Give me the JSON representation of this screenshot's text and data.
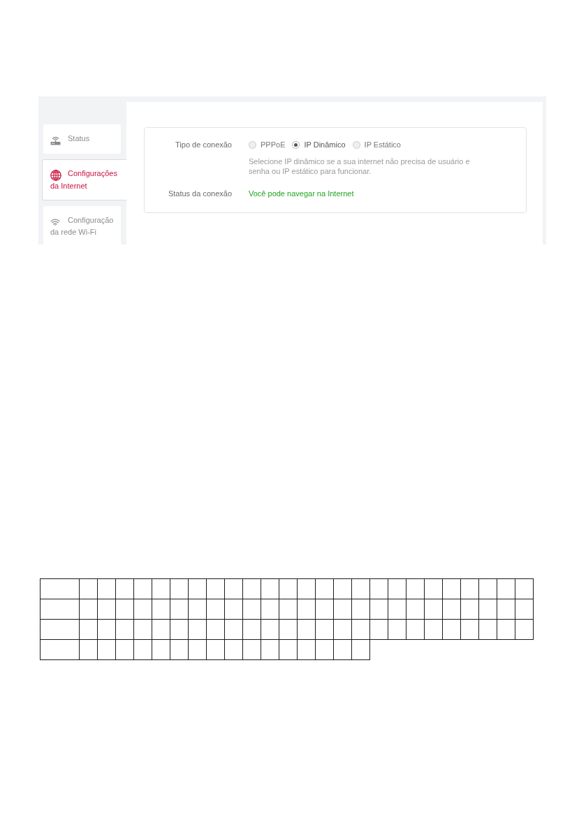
{
  "sidebar": {
    "items": [
      {
        "kind": "status",
        "label": "Status",
        "selected": false
      },
      {
        "kind": "internet",
        "label": "Configurações da Internet",
        "selected": true
      },
      {
        "kind": "wireless",
        "label": "Configuração da rede Wi-Fi",
        "selected": false
      }
    ]
  },
  "connection_form": {
    "connection_type": {
      "label": "Tipo de conexão",
      "options": [
        {
          "label": "PPPoE",
          "selected": false
        },
        {
          "label": "IP Dinâmico",
          "selected": true
        },
        {
          "label": "IP Estático",
          "selected": false
        }
      ],
      "description": "Selecione IP dinâmico se a sua internet não precisa de usuário e senha ou IP estático para funcionar."
    },
    "connection_status": {
      "label": "Status da conexão",
      "value": "Você pode navegar na Internet"
    }
  },
  "grid": {
    "rows": [
      {
        "cells": [
          {
            "kind": "wide"
          },
          {
            "kind": "narrow"
          },
          {
            "kind": "narrow"
          },
          {
            "kind": "narrow"
          },
          {
            "kind": "narrow"
          },
          {
            "kind": "narrow"
          },
          {
            "kind": "narrow"
          },
          {
            "kind": "narrow"
          },
          {
            "kind": "narrow"
          },
          {
            "kind": "narrow"
          },
          {
            "kind": "narrow"
          },
          {
            "kind": "narrow"
          },
          {
            "kind": "narrow"
          },
          {
            "kind": "narrow"
          },
          {
            "kind": "narrow"
          },
          {
            "kind": "narrow"
          },
          {
            "kind": "narrow"
          },
          {
            "kind": "narrow"
          },
          {
            "kind": "narrow"
          },
          {
            "kind": "narrow"
          },
          {
            "kind": "narrow"
          },
          {
            "kind": "narrow"
          },
          {
            "kind": "narrow"
          },
          {
            "kind": "narrow"
          },
          {
            "kind": "narrow"
          },
          {
            "kind": "narrow"
          }
        ]
      },
      {
        "cells": [
          {
            "kind": "wide"
          },
          {
            "kind": "narrow"
          },
          {
            "kind": "narrow"
          },
          {
            "kind": "narrow"
          },
          {
            "kind": "narrow"
          },
          {
            "kind": "narrow"
          },
          {
            "kind": "narrow"
          },
          {
            "kind": "narrow"
          },
          {
            "kind": "narrow"
          },
          {
            "kind": "narrow"
          },
          {
            "kind": "narrow"
          },
          {
            "kind": "narrow"
          },
          {
            "kind": "narrow"
          },
          {
            "kind": "narrow"
          },
          {
            "kind": "narrow"
          },
          {
            "kind": "narrow"
          },
          {
            "kind": "narrow"
          },
          {
            "kind": "narrow"
          },
          {
            "kind": "narrow"
          },
          {
            "kind": "narrow"
          },
          {
            "kind": "narrow"
          },
          {
            "kind": "narrow"
          },
          {
            "kind": "narrow"
          },
          {
            "kind": "narrow"
          },
          {
            "kind": "narrow"
          },
          {
            "kind": "narrow"
          }
        ]
      },
      {
        "cells": [
          {
            "kind": "wide"
          },
          {
            "kind": "narrow"
          },
          {
            "kind": "narrow"
          },
          {
            "kind": "narrow"
          },
          {
            "kind": "narrow"
          },
          {
            "kind": "narrow"
          },
          {
            "kind": "narrow"
          },
          {
            "kind": "narrow"
          },
          {
            "kind": "narrow"
          },
          {
            "kind": "narrow"
          },
          {
            "kind": "narrow"
          },
          {
            "kind": "narrow"
          },
          {
            "kind": "narrow"
          },
          {
            "kind": "narrow"
          },
          {
            "kind": "narrow"
          },
          {
            "kind": "narrow"
          },
          {
            "kind": "narrow"
          },
          {
            "kind": "narrow"
          },
          {
            "kind": "narrow"
          },
          {
            "kind": "narrow"
          },
          {
            "kind": "narrow"
          },
          {
            "kind": "narrow"
          },
          {
            "kind": "narrow"
          },
          {
            "kind": "narrow"
          },
          {
            "kind": "narrow"
          },
          {
            "kind": "narrow"
          }
        ]
      },
      {
        "cells": [
          {
            "kind": "wide"
          },
          {
            "kind": "narrow"
          },
          {
            "kind": "narrow"
          },
          {
            "kind": "narrow"
          },
          {
            "kind": "narrow"
          },
          {
            "kind": "narrow"
          },
          {
            "kind": "narrow"
          },
          {
            "kind": "narrow"
          },
          {
            "kind": "narrow"
          },
          {
            "kind": "narrow"
          },
          {
            "kind": "narrow"
          },
          {
            "kind": "narrow"
          },
          {
            "kind": "narrow"
          },
          {
            "kind": "narrow"
          },
          {
            "kind": "narrow"
          },
          {
            "kind": "narrow"
          },
          {
            "kind": "narrow"
          }
        ]
      }
    ]
  }
}
